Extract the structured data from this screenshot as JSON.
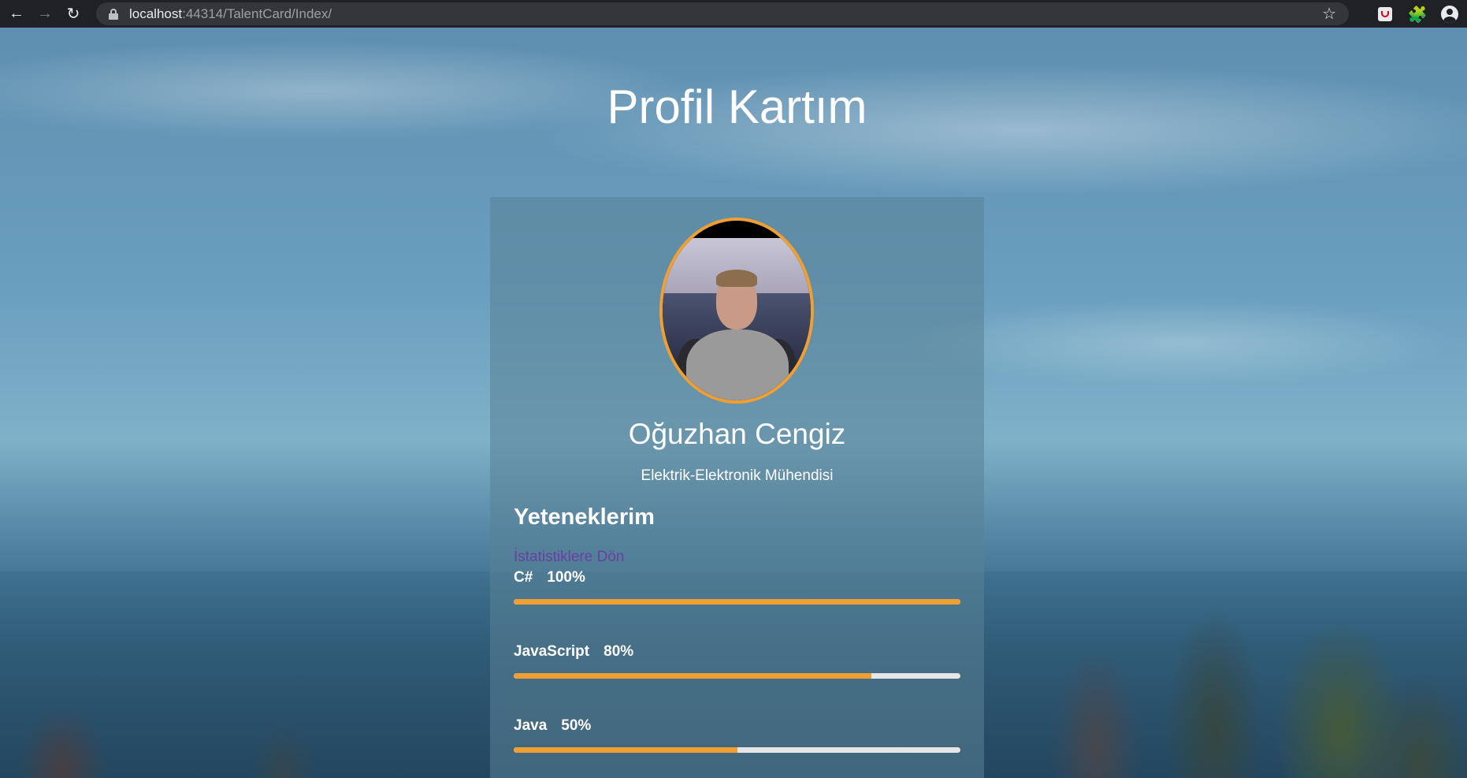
{
  "browser": {
    "url_host": "localhost",
    "url_rest": ":44314/TalentCard/Index/"
  },
  "page": {
    "title": "Profil Kartım"
  },
  "profile": {
    "name": "Oğuzhan Cengiz",
    "job_title": "Elektrik-Elektronik Mühendisi",
    "skills_heading": "Yeteneklerim",
    "back_link": "İstatistiklere Dön"
  },
  "skills": [
    {
      "name": "C#",
      "percent_label": "100%",
      "level": 1.0
    },
    {
      "name": "JavaScript",
      "percent_label": "80%",
      "level": 0.8
    },
    {
      "name": "Java",
      "percent_label": "50%",
      "level": 0.5
    }
  ],
  "colors": {
    "accent": "#f0a032",
    "link": "#6a3fa0"
  }
}
